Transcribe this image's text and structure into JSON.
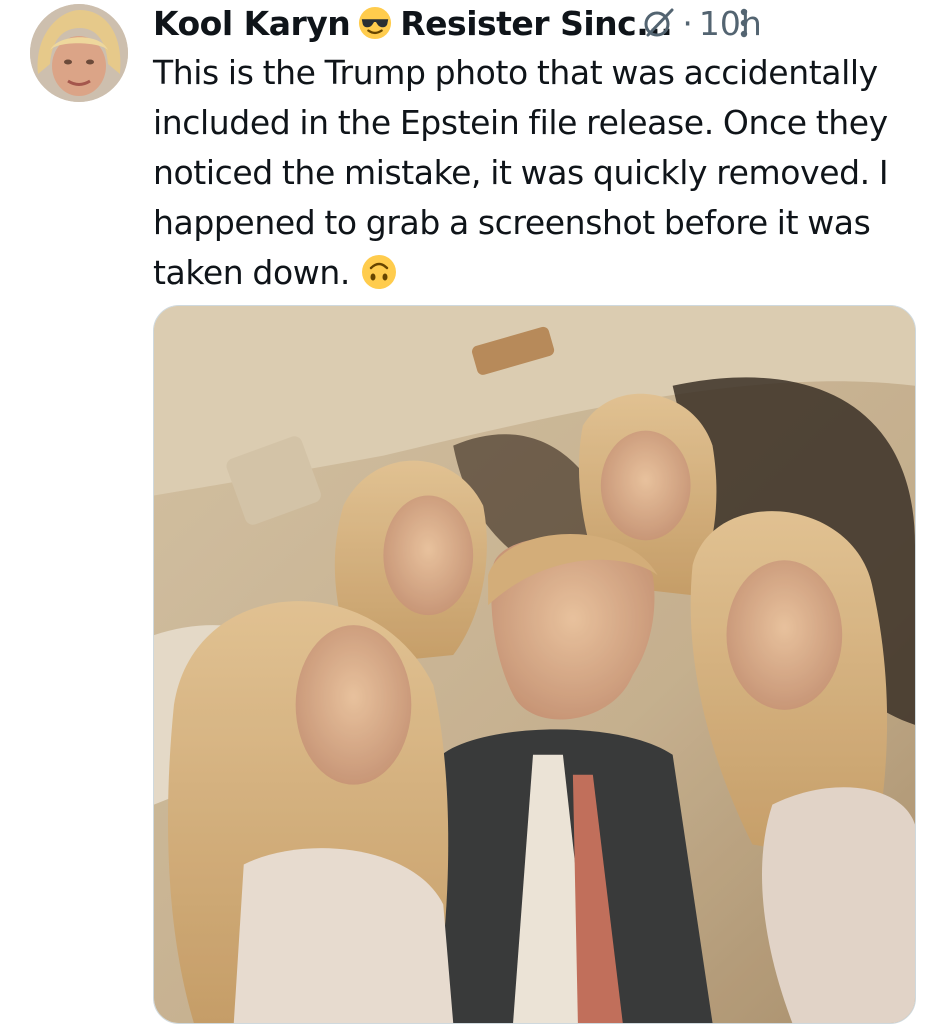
{
  "post": {
    "author_display_name": "Kool Karyn",
    "author_name_suffix": "Resister Sinc...",
    "name_emoji": "smiling-face-with-sunglasses",
    "separator": "·",
    "timestamp": "10h",
    "text": "This is the Trump photo that was accidentally included in the Epstein file release. Once they noticed the mistake, it was quickly removed. I happened to grab a screenshot before it was taken down.",
    "trailing_emoji": "upside-down-face",
    "icons": {
      "avatar": "avatar",
      "grok": "grok-icon",
      "more": "more-options-icon"
    },
    "colors": {
      "text": "#0f1419",
      "secondary": "#536471",
      "border": "#cfd9de"
    }
  }
}
